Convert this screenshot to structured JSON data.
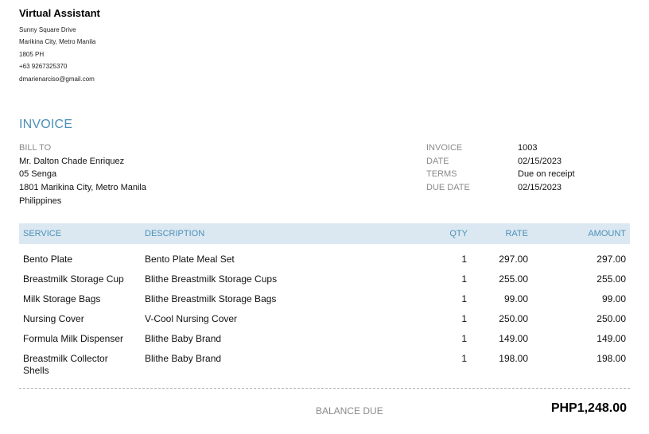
{
  "company": {
    "name": "Virtual Assistant",
    "address_lines": [
      "Sunny Square Drive",
      "Marikina City, Metro Manila",
      "1805 PH",
      "+63 9267325370",
      "dmarienarciso@gmail.com"
    ]
  },
  "title": "INVOICE",
  "bill_to": {
    "label": "BILL TO",
    "lines": [
      "Mr. Dalton Chade Enriquez",
      "05 Senga",
      "1801 Marikina City, Metro Manila",
      "Philippines"
    ]
  },
  "meta": [
    {
      "label": "INVOICE",
      "value": "1003"
    },
    {
      "label": "DATE",
      "value": "02/15/2023"
    },
    {
      "label": "TERMS",
      "value": "Due on receipt"
    },
    {
      "label": "DUE DATE",
      "value": "02/15/2023"
    }
  ],
  "table": {
    "headers": {
      "service": "SERVICE",
      "description": "DESCRIPTION",
      "qty": "QTY",
      "rate": "RATE",
      "amount": "AMOUNT"
    },
    "rows": [
      {
        "service": "Bento Plate",
        "description": "Bento Plate Meal Set",
        "qty": "1",
        "rate": "297.00",
        "amount": "297.00"
      },
      {
        "service": "Breastmilk Storage Cup",
        "description": "Blithe Breastmilk Storage Cups",
        "qty": "1",
        "rate": "255.00",
        "amount": "255.00"
      },
      {
        "service": "Milk Storage Bags",
        "description": "Blithe Breastmilk Storage Bags",
        "qty": "1",
        "rate": "99.00",
        "amount": "99.00"
      },
      {
        "service": "Nursing Cover",
        "description": "V-Cool Nursing Cover",
        "qty": "1",
        "rate": "250.00",
        "amount": "250.00"
      },
      {
        "service": "Formula Milk Dispenser",
        "description": "Blithe Baby Brand",
        "qty": "1",
        "rate": "149.00",
        "amount": "149.00"
      },
      {
        "service": "Breastmilk Collector Shells",
        "description": "Blithe Baby Brand",
        "qty": "1",
        "rate": "198.00",
        "amount": "198.00"
      }
    ]
  },
  "balance": {
    "label": "BALANCE DUE",
    "value": "PHP1,248.00"
  },
  "colors": {
    "accent": "#4a90b8",
    "header_bg": "#dce8f1",
    "muted": "#8a8a8a"
  }
}
